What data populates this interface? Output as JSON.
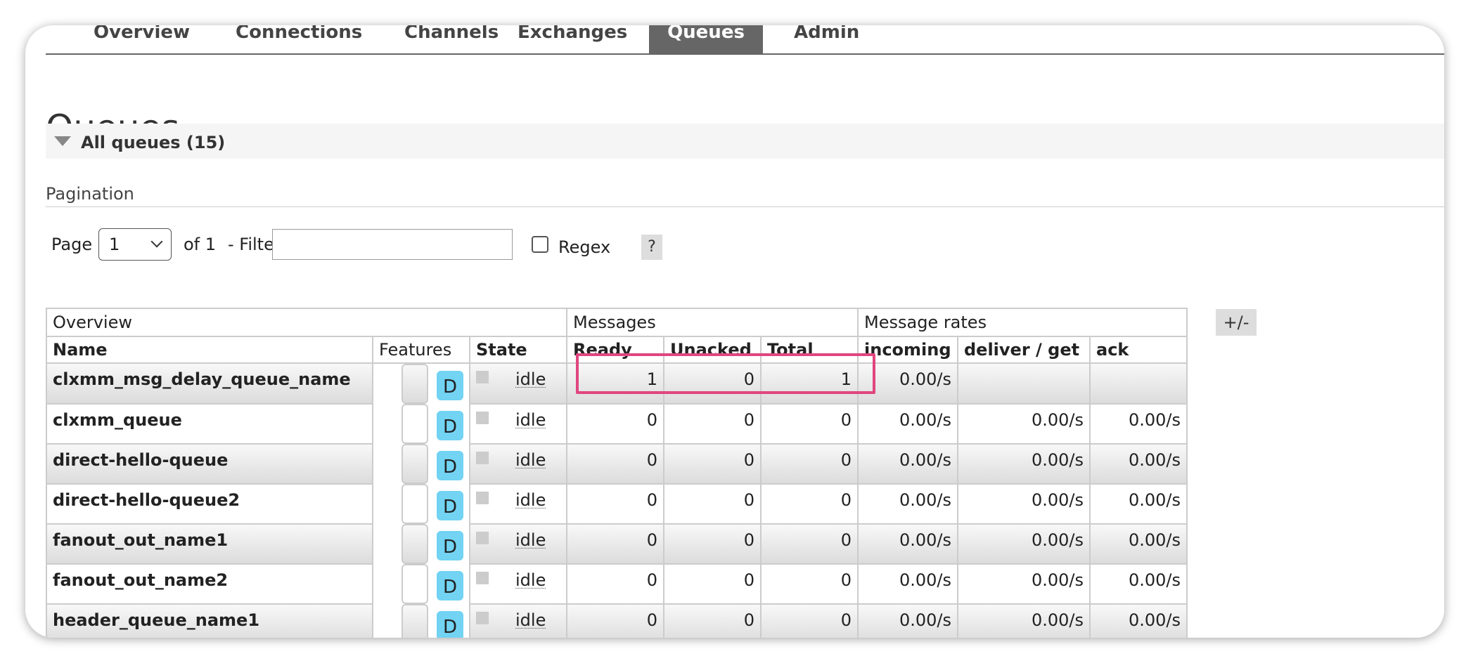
{
  "nav": {
    "items": [
      {
        "label": "Overview",
        "active": false
      },
      {
        "label": "Connections",
        "active": false
      },
      {
        "label": "Channels",
        "active": false
      },
      {
        "label": "Exchanges",
        "active": false
      },
      {
        "label": "Queues",
        "active": true
      },
      {
        "label": "Admin",
        "active": false
      }
    ]
  },
  "page": {
    "title": "Queues",
    "section_label": "All queues (15)"
  },
  "pagination": {
    "heading": "Pagination",
    "page_label": "Page",
    "page_value": "1",
    "of_label": "of 1",
    "filter_label": "- Filter:",
    "filter_value": "",
    "regex_label": "Regex",
    "regex_checked": false,
    "help_label": "?"
  },
  "table": {
    "groups": [
      "Overview",
      "Messages",
      "Message rates"
    ],
    "columns_toggle": "+/-",
    "headers": [
      "Name",
      "Features",
      "State",
      "Ready",
      "Unacked",
      "Total",
      "incoming",
      "deliver / get",
      "ack"
    ],
    "rows": [
      {
        "name": "clxmm_msg_delay_queue_name",
        "feature": "D",
        "state": "idle",
        "ready": "1",
        "unacked": "0",
        "total": "1",
        "incoming": "0.00/s",
        "deliver_get": "",
        "ack": ""
      },
      {
        "name": "clxmm_queue",
        "feature": "D",
        "state": "idle",
        "ready": "0",
        "unacked": "0",
        "total": "0",
        "incoming": "0.00/s",
        "deliver_get": "0.00/s",
        "ack": "0.00/s"
      },
      {
        "name": "direct-hello-queue",
        "feature": "D",
        "state": "idle",
        "ready": "0",
        "unacked": "0",
        "total": "0",
        "incoming": "0.00/s",
        "deliver_get": "0.00/s",
        "ack": "0.00/s"
      },
      {
        "name": "direct-hello-queue2",
        "feature": "D",
        "state": "idle",
        "ready": "0",
        "unacked": "0",
        "total": "0",
        "incoming": "0.00/s",
        "deliver_get": "0.00/s",
        "ack": "0.00/s"
      },
      {
        "name": "fanout_out_name1",
        "feature": "D",
        "state": "idle",
        "ready": "0",
        "unacked": "0",
        "total": "0",
        "incoming": "0.00/s",
        "deliver_get": "0.00/s",
        "ack": "0.00/s"
      },
      {
        "name": "fanout_out_name2",
        "feature": "D",
        "state": "idle",
        "ready": "0",
        "unacked": "0",
        "total": "0",
        "incoming": "0.00/s",
        "deliver_get": "0.00/s",
        "ack": "0.00/s"
      },
      {
        "name": "header_queue_name1",
        "feature": "D",
        "state": "idle",
        "ready": "0",
        "unacked": "0",
        "total": "0",
        "incoming": "0.00/s",
        "deliver_get": "0.00/s",
        "ack": "0.00/s"
      }
    ]
  },
  "colors": {
    "active_tab": "#666666",
    "feature_badge": "#72d3f3",
    "highlight_box": "#e0467f"
  }
}
